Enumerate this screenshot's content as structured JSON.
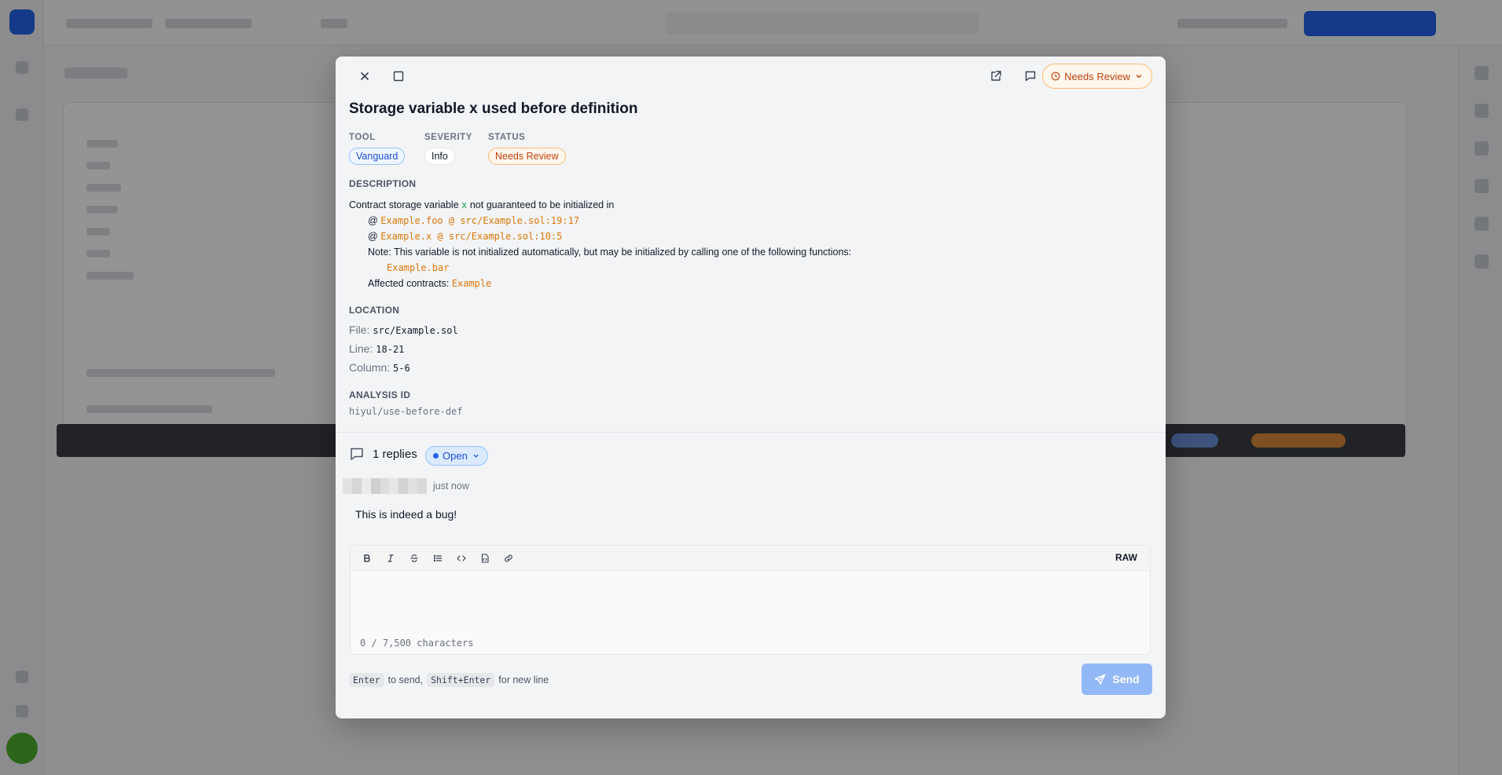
{
  "modal": {
    "status_dropdown": "Needs Review",
    "title": "Storage variable x used before definition",
    "meta": {
      "tool_label": "TOOL",
      "tool_value": "Vanguard",
      "severity_label": "SEVERITY",
      "severity_value": "Info",
      "status_label": "STATUS",
      "status_value": "Needs Review"
    },
    "description": {
      "label": "DESCRIPTION",
      "line1_pre": "Contract storage variable",
      "line1_code": "x",
      "line1_post": "not guaranteed to be initialized in",
      "at1_prefix": "@",
      "at1": "Example.foo @ src/Example.sol:19:17",
      "at2_prefix": "@",
      "at2": "Example.x @ src/Example.sol:10:5",
      "note": "Note: This variable is not initialized automatically, but may be initialized by calling one of the following functions:",
      "note_fn": "Example.bar",
      "affected_label": "Affected contracts:",
      "affected_value": "Example"
    },
    "location": {
      "label": "LOCATION",
      "file_label": "File:",
      "file_value": "src/Example.sol",
      "line_label": "Line:",
      "line_value": "18-21",
      "column_label": "Column:",
      "column_value": "5-6"
    },
    "analysis": {
      "label": "ANALYSIS ID",
      "value": "hiyul/use-before-def"
    },
    "thread": {
      "replies": "1 replies",
      "state": "Open",
      "time": "just now",
      "comment": "This is indeed a bug!"
    },
    "editor": {
      "raw_label": "RAW",
      "char_count": "0 / 7,500 characters"
    },
    "hint": {
      "enter_key": "Enter",
      "enter_text": "to send,",
      "shift_key": "Shift+Enter",
      "shift_text": "for new line"
    },
    "send_label": "Send"
  },
  "colors": {
    "accent": "#2563eb",
    "warning": "#c2410c",
    "code_orange": "#d97706",
    "code_green": "#16a34a"
  }
}
